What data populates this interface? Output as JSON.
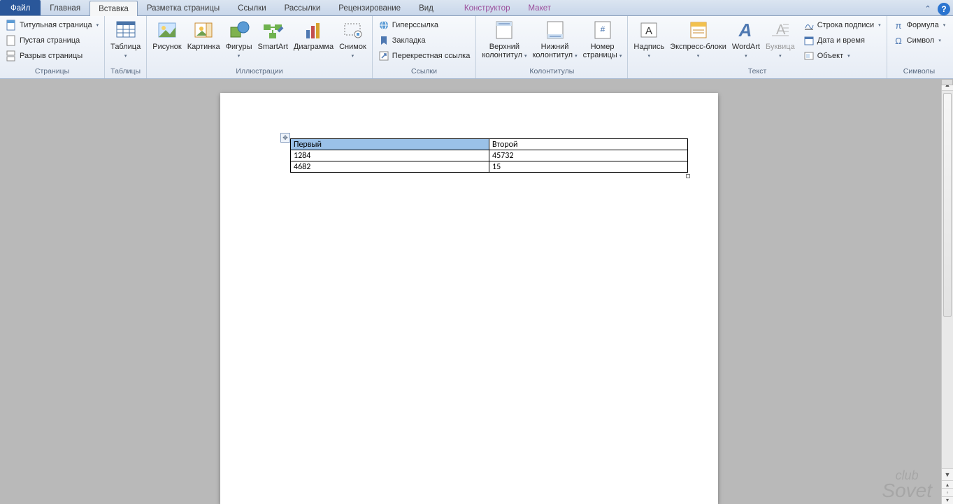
{
  "tabs": {
    "file": "Файл",
    "home": "Главная",
    "insert": "Вставка",
    "layout": "Разметка страницы",
    "references": "Ссылки",
    "mailings": "Рассылки",
    "review": "Рецензирование",
    "view": "Вид",
    "ctx_design": "Конструктор",
    "ctx_layout": "Макет"
  },
  "groups": {
    "pages": "Страницы",
    "tables": "Таблицы",
    "illustrations": "Иллюстрации",
    "links": "Ссылки",
    "headerfooter": "Колонтитулы",
    "text": "Текст",
    "symbols": "Символы"
  },
  "buttons": {
    "cover_page": "Титульная страница",
    "blank_page": "Пустая страница",
    "page_break": "Разрыв страницы",
    "table": "Таблица",
    "picture": "Рисунок",
    "clipart": "Картинка",
    "shapes": "Фигуры",
    "smartart": "SmartArt",
    "chart": "Диаграмма",
    "screenshot": "Снимок",
    "hyperlink": "Гиперссылка",
    "bookmark": "Закладка",
    "crossref": "Перекрестная ссылка",
    "header": "Верхний\nколонтитул",
    "footer": "Нижний\nколонтитул",
    "page_number": "Номер\nстраницы",
    "textbox": "Надпись",
    "quickparts": "Экспресс-блоки",
    "wordart": "WordArt",
    "dropcap": "Буквица",
    "sig_line": "Строка подписи",
    "datetime": "Дата и время",
    "object": "Объект",
    "equation": "Формула",
    "symbol": "Символ"
  },
  "table_data": {
    "headers": [
      "Первый",
      "Второй"
    ],
    "rows": [
      [
        "1284",
        "45732"
      ],
      [
        "4682",
        "15"
      ]
    ]
  },
  "watermark": {
    "top": "club",
    "bottom": "Sovet"
  }
}
